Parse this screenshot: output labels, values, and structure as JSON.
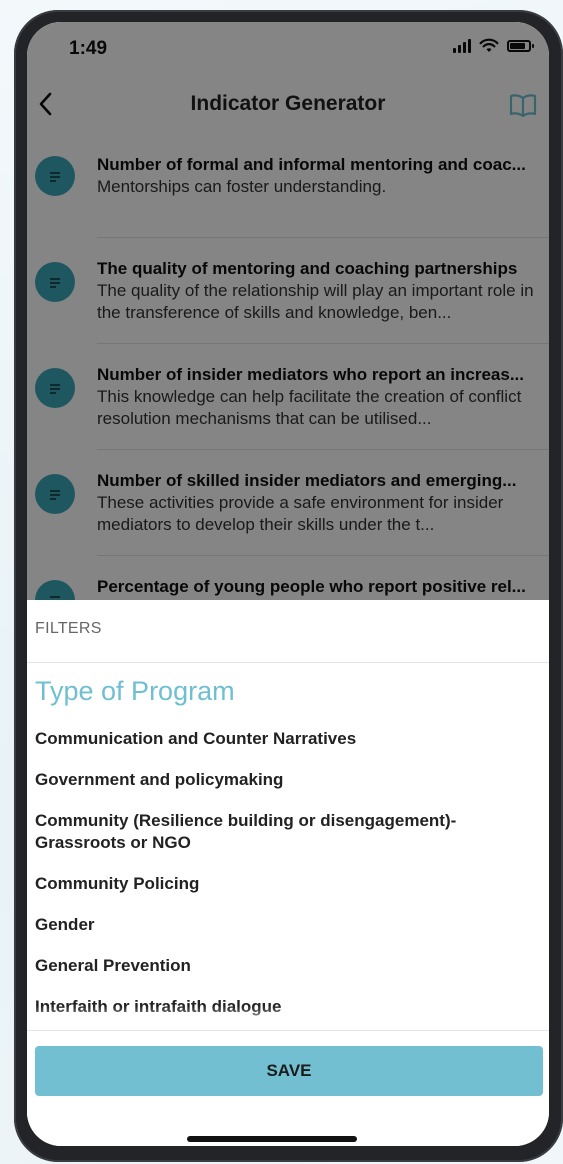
{
  "status_bar": {
    "time": "1:49",
    "icons": [
      "signal-icon",
      "wifi-icon",
      "battery-icon"
    ]
  },
  "nav": {
    "title": "Indicator Generator",
    "back_icon": "chevron-left-icon",
    "book_icon": "book-icon"
  },
  "indicators": [
    {
      "title": "Number of formal and informal mentoring and coac...",
      "description": "Mentorships can foster understanding."
    },
    {
      "title": "The quality of mentoring and coaching partnerships",
      "description": "The quality of the relationship will play an important role in the transference of skills and knowledge, ben..."
    },
    {
      "title": "Number of insider mediators who report an increas...",
      "description": "This knowledge can help facilitate the creation of conflict resolution mechanisms that can be utilised..."
    },
    {
      "title": "Number of skilled insider mediators and emerging...",
      "description": "These activities provide a safe environment for insider mediators to develop their skills under the t..."
    },
    {
      "title": "Percentage of young people who report positive rel...",
      "description": ""
    }
  ],
  "filters": {
    "header": "FILTERS",
    "section_title": "Type of Program",
    "options": [
      "Communication and Counter Narratives",
      "Government and policymaking",
      "Community (Resilience building or disengagement)- Grassroots or NGO",
      "Community Policing",
      "Gender",
      "General Prevention",
      "Interfaith or intrafaith dialogue"
    ],
    "save_label": "SAVE"
  },
  "colors": {
    "accent": "#72bfd1",
    "section_title": "#6fbfd2",
    "nav_icon": "#6fbfd2",
    "item_icon": "#3aa7b8"
  }
}
